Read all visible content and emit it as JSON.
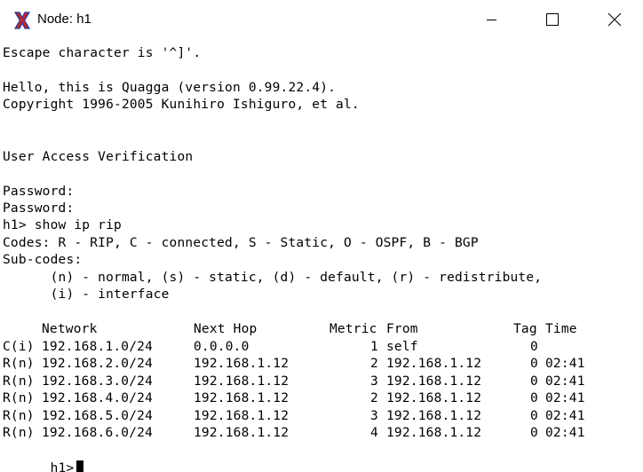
{
  "window": {
    "title": "Node: h1",
    "icon": "x-red-icon",
    "controls": [
      "minimize",
      "maximize",
      "close"
    ]
  },
  "terminal": {
    "lines": {
      "l1": "Escape character is '^]'.",
      "l2": "",
      "l3": "Hello, this is Quagga (version 0.99.22.4).",
      "l4": "Copyright 1996-2005 Kunihiro Ishiguro, et al.",
      "l5": "",
      "l6": "",
      "l7": "User Access Verification",
      "l8": "",
      "l9": "Password:",
      "l10": "Password:",
      "l11": "h1> show ip rip",
      "l12": "Codes: R - RIP, C - connected, S - Static, O - OSPF, B - BGP",
      "l13": "Sub-codes:",
      "l14": "      (n) - normal, (s) - static, (d) - default, (r) - redistribute,",
      "l15": "      (i) - interface",
      "l16": ""
    },
    "rip_table": {
      "headers": {
        "network": "Network",
        "next_hop": "Next Hop",
        "metric": "Metric",
        "from": "From",
        "tag": "Tag",
        "time": "Time"
      },
      "rows": [
        {
          "code": "C(i)",
          "network": "192.168.1.0/24",
          "next_hop": "0.0.0.0",
          "metric": "1",
          "from": "self",
          "tag": "0",
          "time": ""
        },
        {
          "code": "R(n)",
          "network": "192.168.2.0/24",
          "next_hop": "192.168.1.12",
          "metric": "2",
          "from": "192.168.1.12",
          "tag": "0",
          "time": "02:41"
        },
        {
          "code": "R(n)",
          "network": "192.168.3.0/24",
          "next_hop": "192.168.1.12",
          "metric": "3",
          "from": "192.168.1.12",
          "tag": "0",
          "time": "02:41"
        },
        {
          "code": "R(n)",
          "network": "192.168.4.0/24",
          "next_hop": "192.168.1.12",
          "metric": "2",
          "from": "192.168.1.12",
          "tag": "0",
          "time": "02:41"
        },
        {
          "code": "R(n)",
          "network": "192.168.5.0/24",
          "next_hop": "192.168.1.12",
          "metric": "3",
          "from": "192.168.1.12",
          "tag": "0",
          "time": "02:41"
        },
        {
          "code": "R(n)",
          "network": "192.168.6.0/24",
          "next_hop": "192.168.1.12",
          "metric": "4",
          "from": "192.168.1.12",
          "tag": "0",
          "time": "02:41"
        }
      ]
    },
    "prompt": "h1>"
  }
}
